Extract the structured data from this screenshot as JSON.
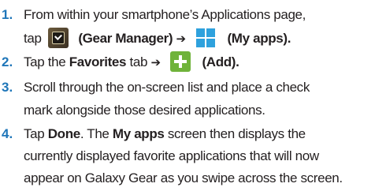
{
  "steps": [
    {
      "number": "1.",
      "line1": "From within your smartphone’s Applications page,",
      "tap": "tap",
      "gear_manager": "(Gear Manager)",
      "arrow": "➔",
      "my_apps": "(My apps).",
      "icons": [
        "gear-manager-icon",
        "my-apps-icon"
      ]
    },
    {
      "number": "2.",
      "tap": "Tap the",
      "favorites": "Favorites",
      "tab": "tab",
      "arrow": "➔",
      "add": "(Add).",
      "icons": [
        "add-icon"
      ]
    },
    {
      "number": "3.",
      "line1": "Scroll through the on-screen list and place a check",
      "line2": "mark alongside those desired applications."
    },
    {
      "number": "4.",
      "tap": "Tap",
      "done": "Done",
      "mid": ". The",
      "my_apps": "My apps",
      "rest": "screen then displays the",
      "line2": "currently displayed favorite applications that will now",
      "line3": "appear on Galaxy Gear as you swipe across the screen."
    }
  ],
  "colors": {
    "step_number": "#1f76b9",
    "text": "#231f20",
    "apps_icon": "#2ea1dd",
    "add_icon": "#6fb33a"
  }
}
